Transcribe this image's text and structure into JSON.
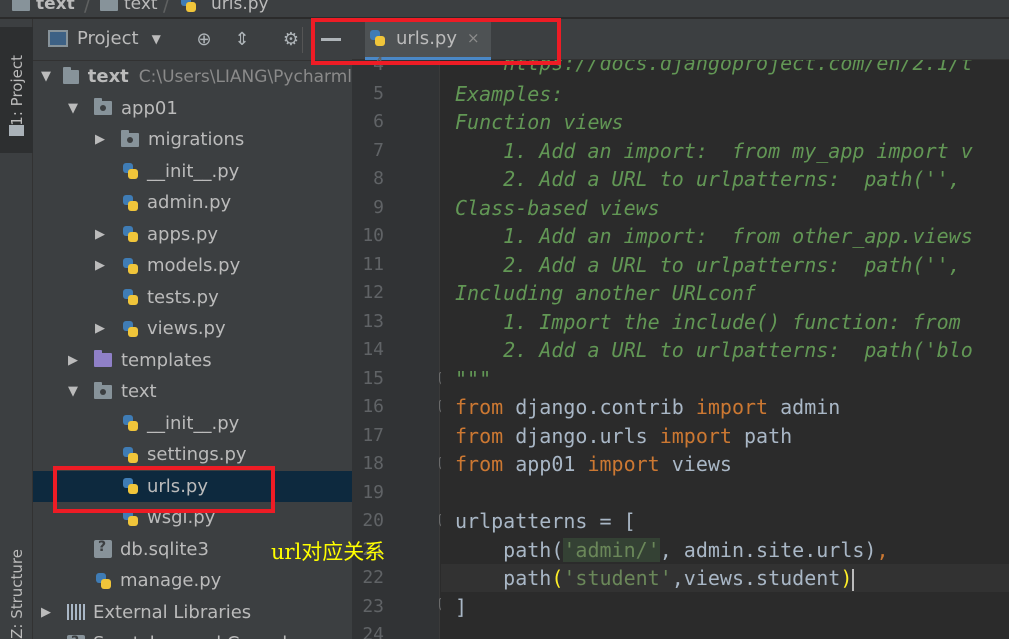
{
  "breadcrumb": {
    "items": [
      {
        "label": "text",
        "bold": true
      },
      {
        "label": "text",
        "bold": false
      },
      {
        "label": "urls.py",
        "bold": false
      }
    ]
  },
  "tool_strip": {
    "project_tab": "1: Project",
    "structure_tab": "Z: Structure"
  },
  "project_panel": {
    "title": "Project",
    "tree": [
      {
        "label": "text",
        "hint": "C:\\Users\\LIANG\\Pycharml",
        "icon": "folder-icon",
        "depth": 0,
        "arrow": "down",
        "bold": true
      },
      {
        "label": "app01",
        "icon": "package-icon",
        "depth": 1,
        "arrow": "down"
      },
      {
        "label": "migrations",
        "icon": "package-icon",
        "depth": 2,
        "arrow": "right"
      },
      {
        "label": "__init__.py",
        "icon": "python-file-icon",
        "depth": 2,
        "arrow": ""
      },
      {
        "label": "admin.py",
        "icon": "python-file-icon",
        "depth": 2,
        "arrow": ""
      },
      {
        "label": "apps.py",
        "icon": "python-file-icon",
        "depth": 2,
        "arrow": "right"
      },
      {
        "label": "models.py",
        "icon": "python-file-icon",
        "depth": 2,
        "arrow": "right"
      },
      {
        "label": "tests.py",
        "icon": "python-file-icon",
        "depth": 2,
        "arrow": ""
      },
      {
        "label": "views.py",
        "icon": "python-file-icon",
        "depth": 2,
        "arrow": "right"
      },
      {
        "label": "templates",
        "icon": "templates-folder-icon",
        "depth": 1,
        "arrow": "right"
      },
      {
        "label": "text",
        "icon": "package-icon",
        "depth": 1,
        "arrow": "down"
      },
      {
        "label": "__init__.py",
        "icon": "python-file-icon",
        "depth": 2,
        "arrow": ""
      },
      {
        "label": "settings.py",
        "icon": "python-file-icon",
        "depth": 2,
        "arrow": ""
      },
      {
        "label": "urls.py",
        "icon": "python-file-icon",
        "depth": 2,
        "arrow": "",
        "selected": true
      },
      {
        "label": "wsgi.py",
        "icon": "python-file-icon",
        "depth": 2,
        "arrow": ""
      },
      {
        "label": "db.sqlite3",
        "icon": "database-file-icon",
        "depth": 1,
        "arrow": ""
      },
      {
        "label": "manage.py",
        "icon": "python-file-icon",
        "depth": 1,
        "arrow": ""
      },
      {
        "label": "External Libraries",
        "icon": "library-icon",
        "depth": 0,
        "arrow": "right"
      },
      {
        "label": "Scratches and Consoles",
        "icon": "scratches-icon",
        "depth": 0,
        "arrow": ""
      }
    ]
  },
  "editor": {
    "tab_label": "urls.py",
    "tab_close": "×",
    "line_numbers": [
      "4",
      "5",
      "6",
      "7",
      "8",
      "9",
      "10",
      "11",
      "12",
      "13",
      "14",
      "15",
      "16",
      "17",
      "18",
      "19",
      "20",
      "21",
      "22",
      "23",
      "24"
    ],
    "lines": {
      "l4": "    https://docs.djangoproject.com/en/2.1/t",
      "l5": "Examples:",
      "l6": "Function views",
      "l7": "    1. Add an import:  from my_app import v",
      "l8": "    2. Add a URL to urlpatterns:  path('',",
      "l9": "Class-based views",
      "l10": "    1. Add an import:  from other_app.views",
      "l11": "    2. Add a URL to urlpatterns:  path('',",
      "l12": "Including another URLconf",
      "l13": "    1. Import the include() function: from",
      "l14": "    2. Add a URL to urlpatterns:  path('blo",
      "l15": "\"\"\"",
      "l16_kw1": "from",
      "l16_mod": " django.contrib ",
      "l16_kw2": "import",
      "l16_name": " admin",
      "l17_kw1": "from",
      "l17_mod": " django.urls ",
      "l17_kw2": "import",
      "l17_name": " path",
      "l18_kw1": "from",
      "l18_mod": " app01 ",
      "l18_kw2": "import",
      "l18_name": " views",
      "l20": "urlpatterns = [",
      "l21_a": "    path(",
      "l21_str": "'admin/'",
      "l21_b": ", admin.site.urls)",
      "l21_c": ",",
      "l22_a": "    path",
      "l22_p1": "(",
      "l22_str": "'student'",
      "l22_b": ",views.student",
      "l22_p2": ")",
      "l23": "]"
    }
  },
  "annotation": {
    "label": "url对应关系",
    "color": "#ee1c25",
    "label_color": "#ffff00"
  }
}
